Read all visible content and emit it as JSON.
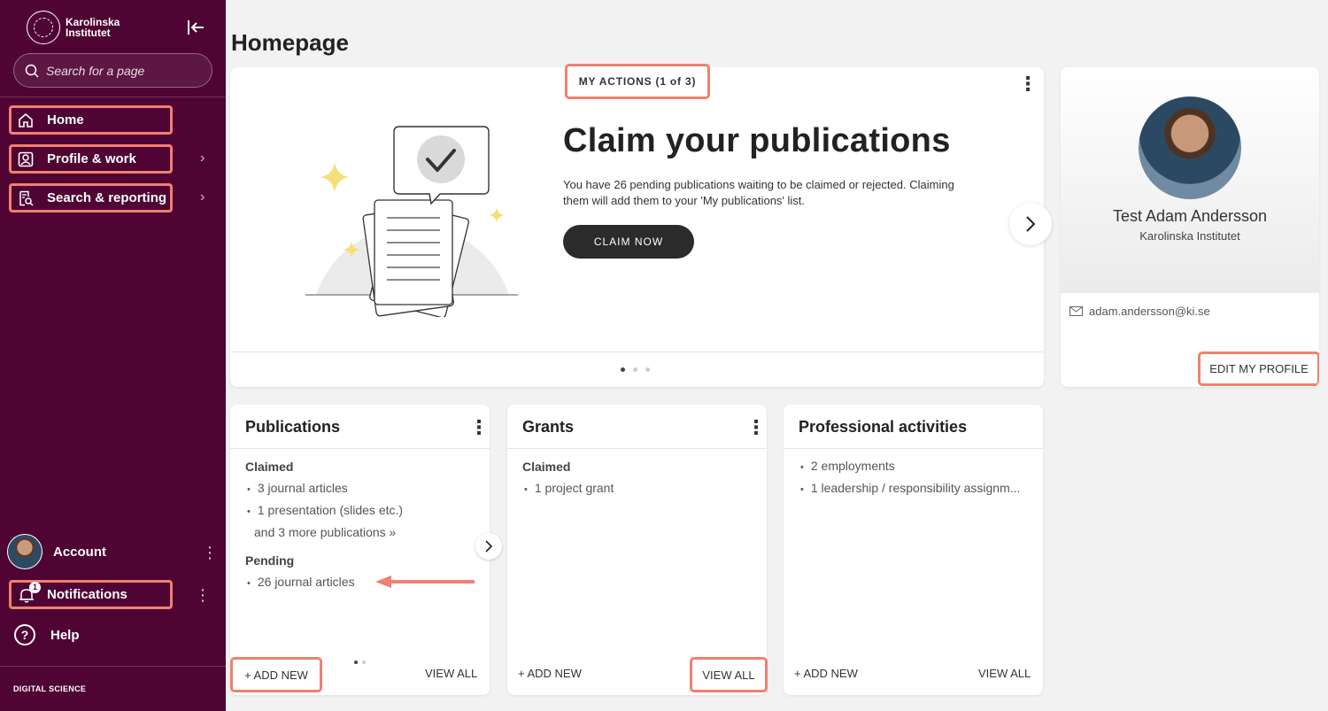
{
  "sidebar": {
    "logo": {
      "line1": "Karolinska",
      "line2": "Institutet"
    },
    "search_placeholder": "Search for a page",
    "nav": [
      {
        "label": "Home"
      },
      {
        "label": "Profile & work"
      },
      {
        "label": "Search & reporting"
      }
    ],
    "account_label": "Account",
    "notifications_label": "Notifications",
    "notifications_count": "1",
    "help_label": "Help",
    "footer": "DIGITAL SCIENCE"
  },
  "page": {
    "title": "Homepage"
  },
  "actions": {
    "tag": "MY ACTIONS (1 of 3)",
    "title": "Claim your publications",
    "text": "You have 26 pending publications waiting to be claimed or rejected. Claiming them will add them to your 'My publications' list.",
    "button": "CLAIM NOW"
  },
  "profile": {
    "name": "Test Adam Andersson",
    "org": "Karolinska Institutet",
    "email": "adam.andersson@ki.se",
    "edit_label": "EDIT MY PROFILE"
  },
  "publications": {
    "title": "Publications",
    "claimed_head": "Claimed",
    "claimed": [
      "3 journal articles",
      "1 presentation (slides etc.)"
    ],
    "more": "and 3 more publications »",
    "pending_head": "Pending",
    "pending": [
      "26 journal articles"
    ],
    "add_label": "+ ADD NEW",
    "view_label": "VIEW ALL"
  },
  "grants": {
    "title": "Grants",
    "claimed_head": "Claimed",
    "claimed": [
      "1 project grant"
    ],
    "add_label": "+ ADD NEW",
    "view_label": "VIEW ALL"
  },
  "activities": {
    "title": "Professional activities",
    "items": [
      "2 employments",
      "1 leadership / responsibility assignm..."
    ],
    "add_label": "+ ADD NEW",
    "view_label": "VIEW ALL"
  },
  "colors": {
    "sidebar": "#4f0433",
    "highlight": "#f08070"
  }
}
